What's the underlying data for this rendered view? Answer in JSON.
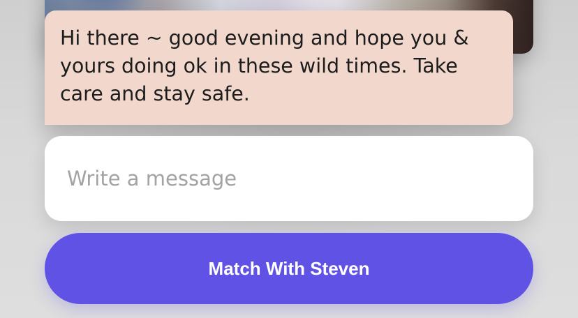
{
  "message": {
    "text": "Hi there ~ good evening and hope you & yours doing ok in these wild times. Take care and stay safe."
  },
  "composer": {
    "placeholder": "Write a message",
    "value": ""
  },
  "actions": {
    "match_label": "Match With Steven"
  },
  "colors": {
    "bubble_background": "#f2d8cc",
    "button_accent": "#6152e6",
    "page_background": "#d6d6d6"
  }
}
